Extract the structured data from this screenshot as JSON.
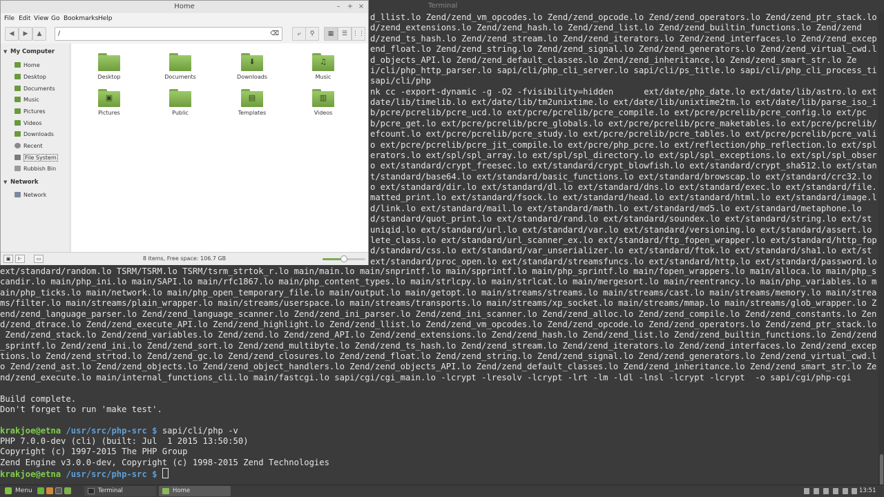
{
  "terminal": {
    "window_title": "Terminal",
    "upper_lines": [
      "d_llist.lo Zend/zend_vm_opcodes.lo Zend/zend_opcode.lo Zend/zend_operators.lo Zend/zend_ptr_stack.lo",
      "d/zend_extensions.lo Zend/zend_hash.lo Zend/zend_list.lo Zend/zend_builtin_functions.lo Zend/zend",
      "d/zend_ts_hash.lo Zend/zend_stream.lo Zend/zend_iterators.lo Zend/zend_interfaces.lo Zend/zend_excep",
      "end_float.lo Zend/zend_string.lo Zend/zend_signal.lo Zend/zend_generators.lo Zend/zend_virtual_cwd.l",
      "d_objects_API.lo Zend/zend_default_classes.lo Zend/zend_inheritance.lo Zend/zend_smart_str.lo Ze",
      "i/cli/php_http_parser.lo sapi/cli/php_cli_server.lo sapi/cli/ps_title.lo sapi/cli/php_cli_process_ti",
      "sapi/cli/php",
      "nk cc -export-dynamic -g -O2 -fvisibility=hidden      ext/date/php_date.lo ext/date/lib/astro.lo ext",
      "date/lib/timelib.lo ext/date/lib/tm2unixtime.lo ext/date/lib/unixtime2tm.lo ext/date/lib/parse_iso_i",
      "b/pcre/pcrelib/pcre_ucd.lo ext/pcre/pcrelib/pcre_compile.lo ext/pcre/pcrelib/pcre_config.lo ext/pc",
      "b/pcre_get.lo ext/pcre/pcrelib/pcre_globals.lo ext/pcre/pcrelib/pcre_maketables.lo ext/pcre/pcrelib/",
      "efcount.lo ext/pcre/pcrelib/pcre_study.lo ext/pcre/pcrelib/pcre_tables.lo ext/pcre/pcrelib/pcre_vali",
      "o ext/pcre/pcrelib/pcre_jit_compile.lo ext/pcre/php_pcre.lo ext/reflection/php_reflection.lo ext/spl/",
      "erators.lo ext/spl/spl_array.lo ext/spl/spl_directory.lo ext/spl/spl_exceptions.lo ext/spl/spl_obser",
      "o ext/standard/crypt_freesec.lo ext/standard/crypt_blowfish.lo ext/standard/crypt_sha512.lo ext/stan",
      "t/standard/base64.lo ext/standard/basic_functions.lo ext/standard/browscap.lo ext/standard/crc32.lo",
      "o ext/standard/dir.lo ext/standard/dl.lo ext/standard/dns.lo ext/standard/exec.lo ext/standard/file.",
      "matted_print.lo ext/standard/fsock.lo ext/standard/head.lo ext/standard/html.lo ext/standard/image.l",
      "d/link.lo ext/standard/mail.lo ext/standard/math.lo ext/standard/md5.lo ext/standard/metaphone.lo",
      "d/standard/quot_print.lo ext/standard/rand.lo ext/standard/soundex.lo ext/standard/string.lo ext/st",
      "uniqid.lo ext/standard/url.lo ext/standard/var.lo ext/standard/versioning.lo ext/standard/assert.lo",
      "lete_class.lo ext/standard/url_scanner_ex.lo ext/standard/ftp_fopen_wrapper.lo ext/standard/http_fop",
      "d/standard/css.lo ext/standard/var_unserializer.lo ext/standard/ftok.lo ext/standard/sha1.lo ext/st",
      "ext/standard/proc_open.lo ext/standard/streamsfuncs.lo ext/standard/http.lo ext/standard/password.lo"
    ],
    "lower_lines": [
      "ext/standard/random.lo TSRM/TSRM.lo TSRM/tsrm_strtok_r.lo main/main.lo main/snprintf.lo main/spprintf.lo main/php_sprintf.lo main/fopen_wrappers.lo main/alloca.lo main/php_s",
      "candir.lo main/php_ini.lo main/SAPI.lo main/rfc1867.lo main/php_content_types.lo main/strlcpy.lo main/strlcat.lo main/mergesort.lo main/reentrancy.lo main/php_variables.lo m",
      "ain/php_ticks.lo main/network.lo main/php_open_temporary_file.lo main/output.lo main/getopt.lo main/streams/streams.lo main/streams/cast.lo main/streams/memory.lo main/strea",
      "ms/filter.lo main/streams/plain_wrapper.lo main/streams/userspace.lo main/streams/transports.lo main/streams/xp_socket.lo main/streams/mmap.lo main/streams/glob_wrapper.lo Z",
      "end/zend_language_parser.lo Zend/zend_language_scanner.lo Zend/zend_ini_parser.lo Zend/zend_ini_scanner.lo Zend/zend_alloc.lo Zend/zend_compile.lo Zend/zend_constants.lo Zen",
      "d/zend_dtrace.lo Zend/zend_execute_API.lo Zend/zend_highlight.lo Zend/zend_llist.lo Zend/zend_vm_opcodes.lo Zend/zend_opcode.lo Zend/zend_operators.lo Zend/zend_ptr_stack.lo",
      " Zend/zend_stack.lo Zend/zend_variables.lo Zend/zend.lo Zend/zend_API.lo Zend/zend_extensions.lo Zend/zend_hash.lo Zend/zend_list.lo Zend/zend_builtin_functions.lo Zend/zend",
      "_sprintf.lo Zend/zend_ini.lo Zend/zend_sort.lo Zend/zend_multibyte.lo Zend/zend_ts_hash.lo Zend/zend_stream.lo Zend/zend_iterators.lo Zend/zend_interfaces.lo Zend/zend_excep",
      "tions.lo Zend/zend_strtod.lo Zend/zend_gc.lo Zend/zend_closures.lo Zend/zend_float.lo Zend/zend_string.lo Zend/zend_signal.lo Zend/zend_generators.lo Zend/zend_virtual_cwd.l",
      "o Zend/zend_ast.lo Zend/zend_objects.lo Zend/zend_object_handlers.lo Zend/zend_objects_API.lo Zend/zend_default_classes.lo Zend/zend_inheritance.lo Zend/zend_smart_str.lo Ze",
      "nd/zend_execute.lo main/internal_functions_cli.lo main/fastcgi.lo sapi/cgi/cgi_main.lo -lcrypt -lresolv -lcrypt -lrt -lm -ldl -lnsl -lcrypt -lcrypt  -o sapi/cgi/php-cgi",
      "",
      "Build complete.",
      "Don't forget to run 'make test'.",
      ""
    ],
    "prompt_user": "krakjoe@etna",
    "prompt_path": "/usr/src/php-src",
    "prompt_symbol": "$",
    "command": "sapi/cli/php -v",
    "output_lines": [
      "PHP 7.0.0-dev (cli) (built: Jul  1 2015 13:50:50)",
      "Copyright (c) 1997-2015 The PHP Group",
      "Zend Engine v3.0.0-dev, Copyright (c) 1998-2015 Zend Technologies"
    ]
  },
  "file_manager": {
    "title": "Home",
    "window_buttons": {
      "minimize": "–",
      "maximize": "+",
      "close": "×"
    },
    "menu": [
      "File",
      "Edit",
      "View",
      "Go",
      "Bookmarks",
      "Help"
    ],
    "nav": {
      "back": "◀",
      "forward": "▶",
      "up": "▲"
    },
    "location": {
      "value": "/",
      "clear_glyph": "⌫"
    },
    "toolbar": {
      "toggle_location": "⤶",
      "search": "⚲",
      "icon_view": "▦",
      "list_view": "☰",
      "compact_view": "⋮⋮"
    },
    "sidebar": {
      "sections": [
        {
          "title": "My Computer",
          "items": [
            "Home",
            "Desktop",
            "Documents",
            "Music",
            "Pictures",
            "Videos",
            "Downloads",
            "Recent",
            "File System",
            "Rubbish Bin"
          ]
        },
        {
          "title": "Network",
          "items": [
            "Network"
          ]
        }
      ],
      "selected": "File System"
    },
    "items": [
      {
        "label": "Desktop",
        "icon": "desktop-folder",
        "glyph": ""
      },
      {
        "label": "Documents",
        "icon": "documents-folder",
        "glyph": ""
      },
      {
        "label": "Downloads",
        "icon": "downloads-folder",
        "glyph": "⬇"
      },
      {
        "label": "Music",
        "icon": "music-folder",
        "glyph": "♫"
      },
      {
        "label": "Pictures",
        "icon": "pictures-folder",
        "glyph": "▣"
      },
      {
        "label": "Public",
        "icon": "public-folder",
        "glyph": ""
      },
      {
        "label": "Templates",
        "icon": "templates-folder",
        "glyph": "▤"
      },
      {
        "label": "Videos",
        "icon": "videos-folder",
        "glyph": "▥"
      }
    ],
    "status": {
      "text": "8 items, Free space: 106.7 GB",
      "zoom_fraction": 0.5
    },
    "status_buttons": [
      "▣",
      "⊩",
      "▭"
    ]
  },
  "taskbar": {
    "menu_label": "Menu",
    "tasks": [
      {
        "label": "Terminal",
        "icon": "terminal-icon"
      },
      {
        "label": "Home",
        "icon": "folder-icon"
      }
    ],
    "clock": "13:51",
    "colors": {
      "accent": "#7fc33e",
      "panel": "#3c3c3c"
    }
  },
  "colors": {
    "terminal_bg": "#3b3b3b",
    "terminal_fg": "#e6e6e6",
    "prompt_user": "#7fcf4a",
    "prompt_path": "#5f9fd8",
    "folder_green": "#8bb85a"
  }
}
